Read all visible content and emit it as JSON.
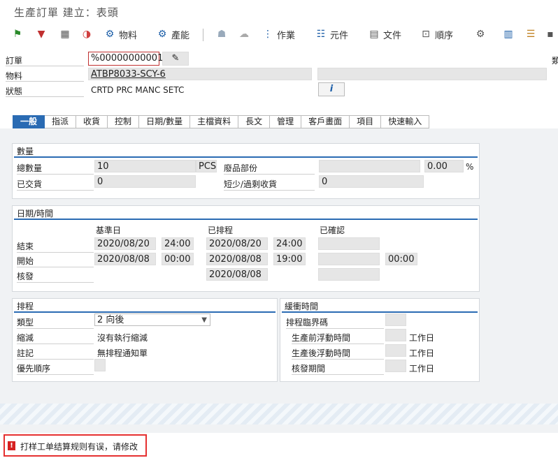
{
  "window": {
    "title": "生產訂單 建立：表頭"
  },
  "toolbar": {
    "material_label": "物料",
    "capacity_label": "產能",
    "operations_label": "作業",
    "components_label": "元件",
    "documents_label": "文件",
    "sequence_label": "順序"
  },
  "header": {
    "order_label": "訂單",
    "order_value": "%00000000001",
    "material_label": "物料",
    "material_value": "ATBP8033-SCY-6",
    "status_label": "狀態",
    "status_value": "CRTD PRC  MANC SETC",
    "side_label": "類"
  },
  "tabs": [
    "一般",
    "指派",
    "收貨",
    "控制",
    "日期/數量",
    "主檔資料",
    "長文",
    "管理",
    "客戶畫面",
    "項目",
    "快速輸入"
  ],
  "quantities": {
    "title": "數量",
    "total_label": "總數量",
    "total_value": "10",
    "unit": "PCS",
    "scrap_label": "廢品部份",
    "scrap_pct": "0.00",
    "pct_sign": "%",
    "delivered_label": "已交貨",
    "delivered_value": "0",
    "short_label": "短少/過剩收貨",
    "short_value": "0"
  },
  "dates": {
    "title": "日期/時間",
    "col_basic": "基準日",
    "col_scheduled": "已排程",
    "col_confirmed": "已確認",
    "end_label": "結束",
    "end_basic_date": "2020/08/20",
    "end_basic_time": "24:00",
    "end_sched_date": "2020/08/20",
    "end_sched_time": "24:00",
    "start_label": "開始",
    "start_basic_date": "2020/08/08",
    "start_basic_time": "00:00",
    "start_sched_date": "2020/08/08",
    "start_sched_time": "19:00",
    "start_conf_time": "00:00",
    "release_label": "核發",
    "release_sched_date": "2020/08/08"
  },
  "scheduling": {
    "title": "排程",
    "type_label": "類型",
    "type_value": "2 向後",
    "reduction_label": "縮減",
    "reduction_value": "沒有執行縮減",
    "note_label": "註記",
    "note_value": "無排程通知單",
    "priority_label": "優先順序"
  },
  "buffer": {
    "title": "緩衝時間",
    "horizon_label": "排程臨界碼",
    "float_before_label": "生產前浮動時間",
    "float_after_label": "生產後浮動時間",
    "release_period_label": "核發期間",
    "unit_label": "工作日"
  },
  "status": {
    "message": "打样工单结算规则有误，请修改"
  },
  "colors": {
    "accent": "#2a6bb3",
    "error": "#d62020"
  }
}
